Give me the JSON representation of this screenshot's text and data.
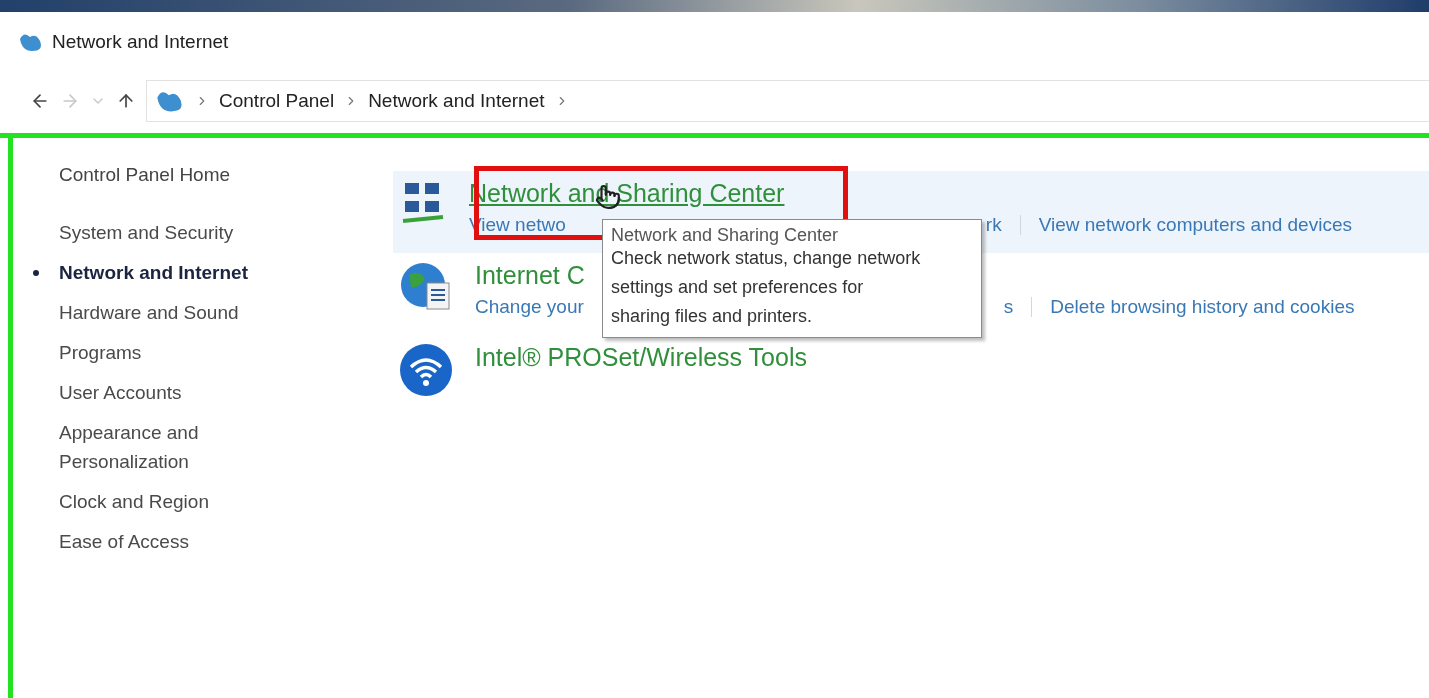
{
  "window": {
    "title": "Network and Internet"
  },
  "breadcrumb": [
    "Control Panel",
    "Network and Internet"
  ],
  "sidebar": {
    "home": "Control Panel Home",
    "items": [
      {
        "label": "System and Security",
        "selected": false
      },
      {
        "label": "Network and Internet",
        "selected": true
      },
      {
        "label": "Hardware and Sound",
        "selected": false
      },
      {
        "label": "Programs",
        "selected": false
      },
      {
        "label": "User Accounts",
        "selected": false
      },
      {
        "label": "Appearance and Personalization",
        "selected": false
      },
      {
        "label": "Clock and Region",
        "selected": false
      },
      {
        "label": "Ease of Access",
        "selected": false
      }
    ]
  },
  "categories": [
    {
      "kind": "network",
      "title": "Network and Sharing Center",
      "hovered": true,
      "links": [
        {
          "label": "View netwo",
          "covered_after": true
        },
        {
          "label": "rk",
          "covered_after": false
        },
        {
          "label": "View network computers and devices",
          "covered_after": false
        }
      ]
    },
    {
      "kind": "internet",
      "title": "Internet C",
      "hovered": false,
      "links": [
        {
          "label": "Change your",
          "covered_after": true
        },
        {
          "label": "s",
          "covered_after": false
        },
        {
          "label": "Delete browsing history and cookies",
          "covered_after": false
        }
      ]
    },
    {
      "kind": "wireless",
      "title": "Intel® PROSet/Wireless Tools",
      "hovered": false
    }
  ],
  "tooltip": {
    "title": "Network and Sharing Center",
    "lines": [
      "Check network status, change network",
      "settings and set preferences for",
      "sharing files and printers."
    ]
  }
}
